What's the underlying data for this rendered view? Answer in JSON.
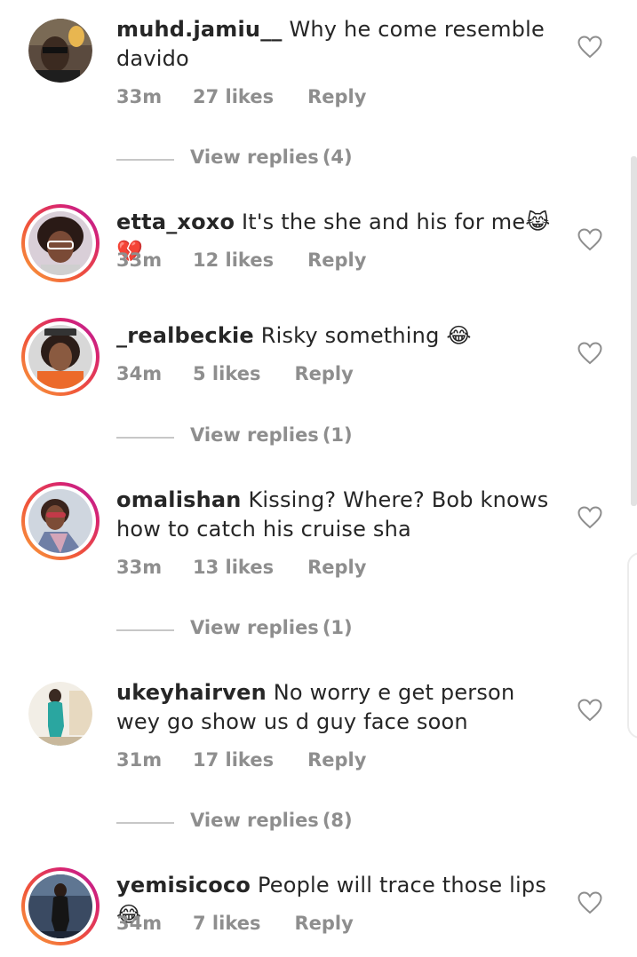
{
  "comments": [
    {
      "username": "muhd.jamiu__",
      "text": "Why he come resemble davido",
      "time": "33m",
      "likes": "27 likes",
      "reply": "Reply",
      "avatar_story": false,
      "view_replies": {
        "label": "View replies",
        "count": "(4)"
      }
    },
    {
      "username": "etta_xoxo",
      "text": "It's the she and his for me😹💔",
      "time": "33m",
      "likes": "12 likes",
      "reply": "Reply",
      "avatar_story": true,
      "view_replies": null
    },
    {
      "username": "_realbeckie",
      "text": "Risky something 😂",
      "time": "34m",
      "likes": "5 likes",
      "reply": "Reply",
      "avatar_story": true,
      "view_replies": {
        "label": "View replies",
        "count": "(1)"
      }
    },
    {
      "username": "omalishan",
      "text": "Kissing? Where? Bob knows how to catch his cruise sha",
      "time": "33m",
      "likes": "13 likes",
      "reply": "Reply",
      "avatar_story": true,
      "view_replies": {
        "label": "View replies",
        "count": "(1)"
      }
    },
    {
      "username": "ukeyhairven",
      "text": "No worry e get person wey go show us d guy face soon",
      "time": "31m",
      "likes": "17 likes",
      "reply": "Reply",
      "avatar_story": false,
      "view_replies": {
        "label": "View replies",
        "count": "(8)"
      }
    },
    {
      "username": "yemisicoco",
      "text": "People will trace those lips 😂",
      "time": "34m",
      "likes": "7 likes",
      "reply": "Reply",
      "avatar_story": true,
      "view_replies": null
    }
  ],
  "icons": {
    "like": "heart-outline-icon"
  },
  "colors": {
    "text": "#262626",
    "meta": "#8e8e8e",
    "divider": "#c7c7c7",
    "story_ring_start": "#f9a33c",
    "story_ring_end": "#b421a6"
  }
}
